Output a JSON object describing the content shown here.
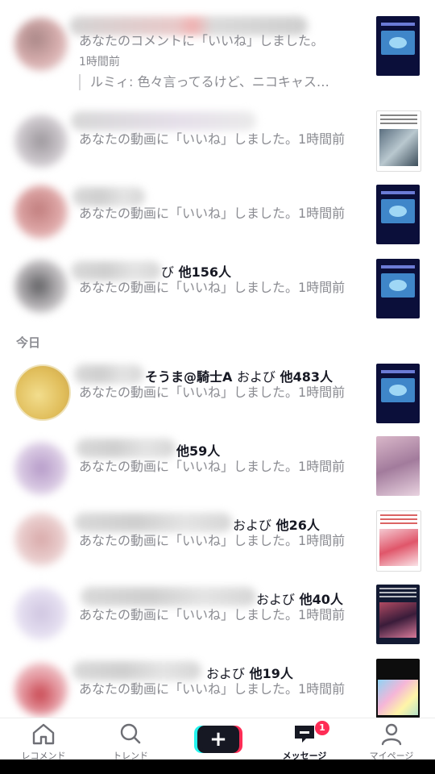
{
  "section_today": "今日",
  "notifications": [
    {
      "tail": "",
      "mid": "",
      "count": "",
      "message": "あなたのコメントに「いいね」しました。",
      "time": "1時間前",
      "quote": "ルミィ: 色々言ってるけど、ニコキャス…",
      "avatar_color": "#c99a9a",
      "thumb": "blue"
    },
    {
      "tail": "",
      "mid": "",
      "count": "",
      "message": "あなたの動画に「いいね」しました。1時間前",
      "time": "",
      "quote": "",
      "avatar_color": "#b9b3b9",
      "thumb": "light"
    },
    {
      "tail": "",
      "mid": "",
      "count": "",
      "message": "あなたの動画に「いいね」しました。1時間前",
      "time": "",
      "quote": "",
      "avatar_color": "#d49a9a",
      "thumb": "blue"
    },
    {
      "tail": "び",
      "mid": "",
      "count": "他156人",
      "message": "あなたの動画に「いいね」しました。1時間前",
      "time": "",
      "quote": "",
      "avatar_color": "#9a9a9e",
      "thumb": "blue"
    },
    {
      "tail": "そうま@騎士A",
      "mid": "および",
      "count": "他483人",
      "message": "あなたの動画に「いいね」しました。1時間前",
      "time": "",
      "quote": "",
      "avatar_color": "#e6c46a",
      "thumb": "blue"
    },
    {
      "tail": "",
      "mid": "",
      "count": "他59人",
      "message": "あなたの動画に「いいね」しました。1時間前",
      "time": "",
      "quote": "",
      "avatar_color": "#c8b0d6",
      "thumb": "pink"
    },
    {
      "tail": "",
      "mid": "および",
      "count": "他26人",
      "message": "あなたの動画に「いいね」しました。1時間前",
      "time": "",
      "quote": "",
      "avatar_color": "#e0b9b9",
      "thumb": "red"
    },
    {
      "tail": "",
      "mid": "および",
      "count": "他40人",
      "message": "あなたの動画に「いいね」しました。1時間前",
      "time": "",
      "quote": "",
      "avatar_color": "#d9d2e6",
      "thumb": "dark2"
    },
    {
      "tail": "",
      "mid": "および",
      "count": "他19人",
      "message": "あなたの動画に「いいね」しました。1時間前",
      "time": "",
      "quote": "",
      "avatar_color": "#e6a8b0",
      "thumb": "anime"
    }
  ],
  "tabs": [
    {
      "label": "レコメンド",
      "icon": "home-icon"
    },
    {
      "label": "トレンド",
      "icon": "search-icon"
    },
    {
      "label": "",
      "icon": "plus-icon"
    },
    {
      "label": "メッセージ",
      "icon": "message-icon",
      "badge": "1"
    },
    {
      "label": "マイページ",
      "icon": "profile-icon"
    }
  ]
}
